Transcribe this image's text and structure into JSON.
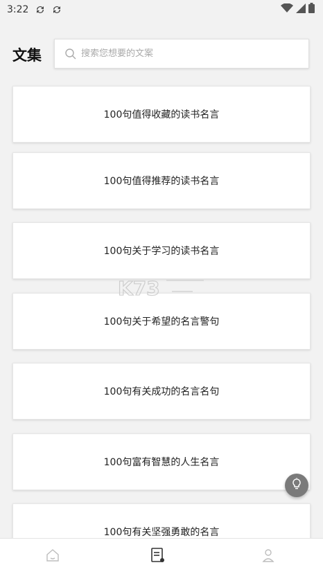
{
  "status_bar": {
    "time": "3:22",
    "left_icons": [
      "sync-icon",
      "sync-icon"
    ],
    "right_icons": [
      "wifi-icon",
      "signal-icon",
      "battery-icon"
    ]
  },
  "header": {
    "title": "文集",
    "search_placeholder": "搜索您想要的文案"
  },
  "collections": [
    "100句值得收藏的读书名言",
    "100句值得推荐的读书名言",
    "100句关于学习的读书名言",
    "100句关于希望的名言警句",
    "100句有关成功的名言名句",
    "100句富有智慧的人生名言",
    "100句有关坚强勇敢的名言"
  ],
  "floating_button": {
    "icon": "lightbulb-icon"
  },
  "bottom_nav": [
    {
      "icon": "home-icon",
      "active": false
    },
    {
      "icon": "document-icon",
      "active": true
    },
    {
      "icon": "profile-icon",
      "active": false
    }
  ],
  "colors": {
    "background": "#f2f2f2",
    "card": "#ffffff",
    "fab": "#7a7a7a",
    "text": "#222222"
  }
}
